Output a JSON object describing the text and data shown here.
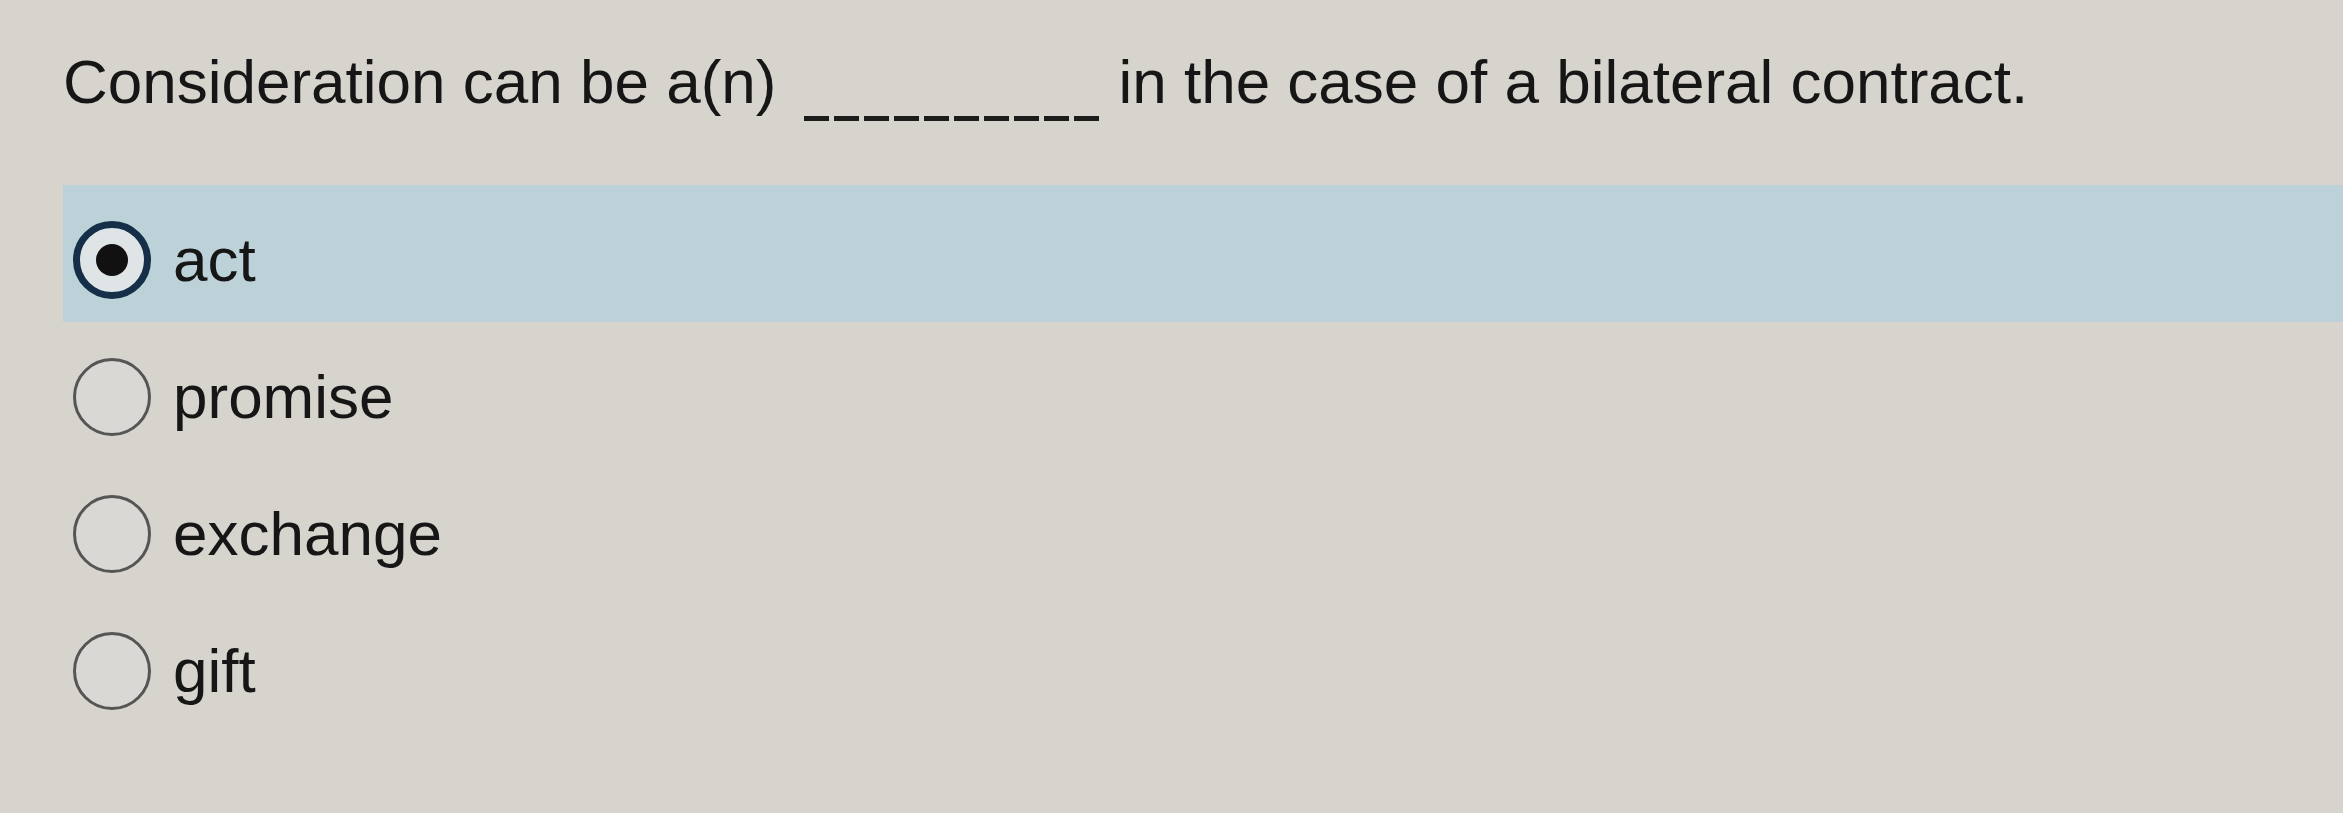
{
  "question": {
    "before": "Consideration can be a(n)",
    "after": "in the case of a bilateral contract."
  },
  "options": [
    {
      "label": "act",
      "selected": true
    },
    {
      "label": "promise",
      "selected": false
    },
    {
      "label": "exchange",
      "selected": false
    },
    {
      "label": "gift",
      "selected": false
    }
  ]
}
